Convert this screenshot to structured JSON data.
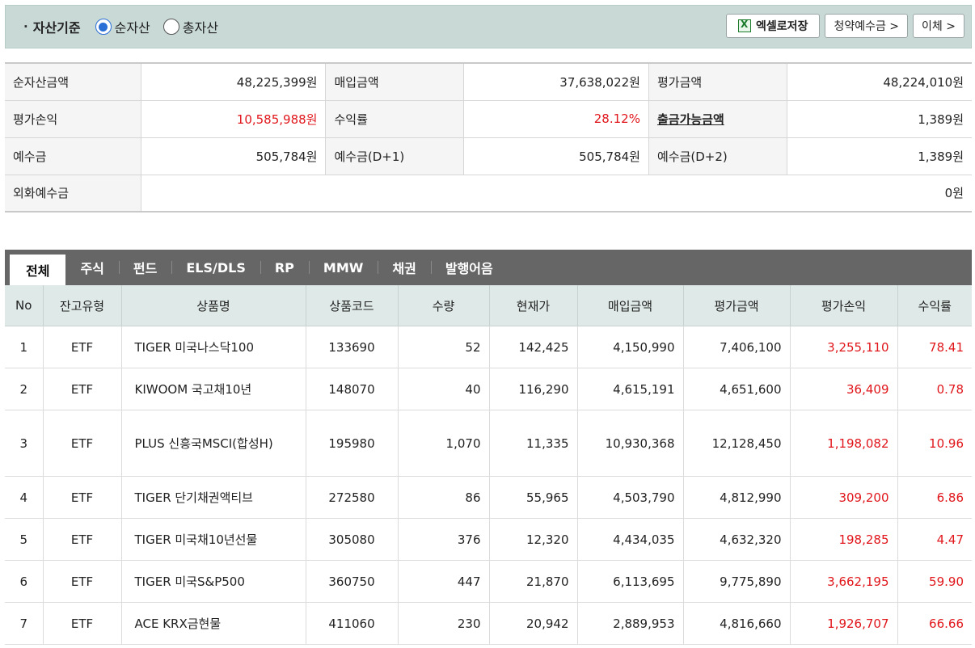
{
  "header": {
    "basis_label": "자산기준",
    "radio_net": "순자산",
    "radio_total": "총자산",
    "selected": "순자산",
    "excel_label": "엑셀로저장",
    "subscription_label": "청약예수금 >",
    "transfer_label": "이체 >"
  },
  "summary": {
    "rows": [
      [
        {
          "k": "순자산금액",
          "v": "48,225,399원"
        },
        {
          "k": "매입금액",
          "v": "37,638,022원"
        },
        {
          "k": "평가금액",
          "v": "48,224,010원"
        }
      ],
      [
        {
          "k": "평가손익",
          "v": "10,585,988원"
        },
        {
          "k": "수익률",
          "v": "28.12%"
        },
        {
          "k": "출금가능금액",
          "v": "1,389원"
        }
      ],
      [
        {
          "k": "예수금",
          "v": "505,784원"
        },
        {
          "k": "예수금(D+1)",
          "v": "505,784원"
        },
        {
          "k": "예수금(D+2)",
          "v": "1,389원"
        }
      ]
    ],
    "fx_label": "외화예수금",
    "fx_value": "0원"
  },
  "tabs": [
    "전체",
    "주식",
    "펀드",
    "ELS/DLS",
    "RP",
    "MMW",
    "채권",
    "발행어음"
  ],
  "active_tab": "전체",
  "table": {
    "headers": [
      "No",
      "잔고유형",
      "상품명",
      "상품코드",
      "수량",
      "현재가",
      "매입금액",
      "평가금액",
      "평가손익",
      "수익률"
    ],
    "rows": [
      [
        "1",
        "ETF",
        "TIGER 미국나스닥100",
        "133690",
        "52",
        "142,425",
        "4,150,990",
        "7,406,100",
        "3,255,110",
        "78.41"
      ],
      [
        "2",
        "ETF",
        "KIWOOM 국고채10년",
        "148070",
        "40",
        "116,290",
        "4,615,191",
        "4,651,600",
        "36,409",
        "0.78"
      ],
      [
        "3",
        "ETF",
        "PLUS 신흥국MSCI(합성H)",
        "195980",
        "1,070",
        "11,335",
        "10,930,368",
        "12,128,450",
        "1,198,082",
        "10.96"
      ],
      [
        "4",
        "ETF",
        "TIGER 단기채권액티브",
        "272580",
        "86",
        "55,965",
        "4,503,790",
        "4,812,990",
        "309,200",
        "6.86"
      ],
      [
        "5",
        "ETF",
        "TIGER 미국채10년선물",
        "305080",
        "376",
        "12,320",
        "4,434,035",
        "4,632,320",
        "198,285",
        "4.47"
      ],
      [
        "6",
        "ETF",
        "TIGER 미국S&P500",
        "360750",
        "447",
        "21,870",
        "6,113,695",
        "9,775,890",
        "3,662,195",
        "59.90"
      ],
      [
        "7",
        "ETF",
        "ACE KRX금현물",
        "411060",
        "230",
        "20,942",
        "2,889,953",
        "4,816,660",
        "1,926,707",
        "66.66"
      ]
    ]
  },
  "colors": {
    "accent_red": "#e0161b",
    "header_bg": "#c8d9d6",
    "tab_bar": "#666666"
  }
}
